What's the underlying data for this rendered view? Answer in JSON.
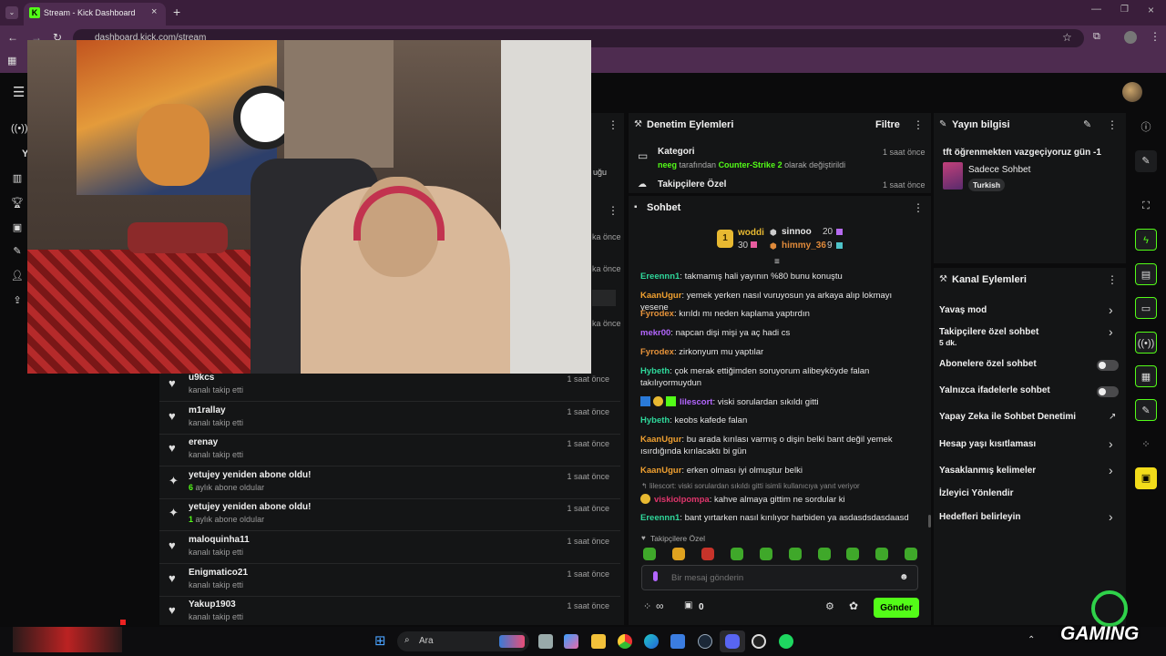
{
  "browser": {
    "tab_title": "Stream - Kick Dashboard",
    "url": "dashboard.kick.com/stream"
  },
  "left_panel": {
    "partial_text_1": "uğu",
    "partial_times": [
      "ka önce",
      "ka önce",
      "ka önce"
    ],
    "feed": [
      {
        "name": "u9kcs",
        "desc": "kanalı takip etti",
        "time": "1 saat önce",
        "type": "follow"
      },
      {
        "name": "m1rallay",
        "desc": "kanalı takip etti",
        "time": "1 saat önce",
        "type": "follow"
      },
      {
        "name": "erenay",
        "desc": "kanalı takip etti",
        "time": "1 saat önce",
        "type": "follow"
      },
      {
        "name": "yetujey yeniden abone oldu!",
        "desc_num": "6",
        "desc": " aylık abone oldular",
        "time": "1 saat önce",
        "type": "sub"
      },
      {
        "name": "yetujey yeniden abone oldu!",
        "desc_num": "1",
        "desc": " aylık abone oldular",
        "time": "1 saat önce",
        "type": "sub"
      },
      {
        "name": "maloquinha11",
        "desc": "kanalı takip etti",
        "time": "1 saat önce",
        "type": "follow"
      },
      {
        "name": "Enigmatico21",
        "desc": "kanalı takip etti",
        "time": "1 saat önce",
        "type": "follow"
      },
      {
        "name": "Yakup1903",
        "desc": "kanalı takip etti",
        "time": "1 saat önce",
        "type": "follow"
      }
    ]
  },
  "moderation": {
    "title": "Denetim Eylemleri",
    "filter_label": "Filtre",
    "entries": [
      {
        "title": "Kategori",
        "user": "neeg",
        "mid": " tarafından ",
        "category": "Counter-Strike 2",
        "tail": " olarak değiştirildi",
        "time": "1 saat önce"
      },
      {
        "title": "Takipçilere Özel",
        "time": "1 saat önce"
      }
    ]
  },
  "chat": {
    "title": "Sohbet",
    "leaderboard": {
      "first": {
        "rank": "1",
        "name": "woddi",
        "value": "30"
      },
      "second": {
        "name": "sinnoo",
        "value": "20"
      },
      "third": {
        "name": "himmy_36",
        "value": "9"
      }
    },
    "messages": [
      {
        "user": "Ereennn1",
        "color": "#2fd89b",
        "text": "takmamış hali yayının %80 bunu konuştu"
      },
      {
        "user": "KaanUgur",
        "color": "#f0a030",
        "text": "yemek yerken nasıl vuruyosun ya arkaya alıp lokmayı yesene"
      },
      {
        "user": "Fyrodex",
        "color": "#e7933a",
        "text": "kırıldı mı neden kaplama yaptırdın"
      },
      {
        "user": "mekr00",
        "color": "#b366ff",
        "text": "napcan dişi mişi ya aç hadi cs"
      },
      {
        "user": "Fyrodex",
        "color": "#e7933a",
        "text": "zirkonyum mu yaptılar"
      },
      {
        "user": "Hybeth",
        "color": "#2fd89b",
        "text": "çok merak ettiğimden soruyorum alibeyköyde falan takılıyormuydun"
      },
      {
        "user": "lilescort",
        "color": "#b366ff",
        "text": "viski sorulardan sıkıldı gitti"
      },
      {
        "user": "Hybeth",
        "color": "#2fd89b",
        "text": "keobs kafede falan"
      },
      {
        "user": "KaanUgur",
        "color": "#f0a030",
        "text": "bu arada kırılası varmış o dişin belki bant değil yemek ısırdığında kırılacaktı bi gün"
      },
      {
        "user": "KaanUgur",
        "color": "#f0a030",
        "text": "erken olması iyi olmuştur belki"
      },
      {
        "user": "viskiolpompa",
        "color": "#e0356c",
        "text": "kahve almaya gittim ne sordular ki"
      },
      {
        "user": "Ereennn1",
        "color": "#2fd89b",
        "text": "bant yırtarken nasıl kırılıyor harbiden ya asdasdsdasdaasd"
      }
    ],
    "reply_hint": "lilescort: viski sorulardan sıkıldı gitti isimli kullanıcıya yanıt veriyor",
    "followers_only": "Takipçilere Özel",
    "input_placeholder": "Bir mesaj gönderin",
    "send_label": "Gönder",
    "points": "0",
    "infinity": "∞"
  },
  "stream_info": {
    "title": "Yayın bilgisi",
    "stream_title": "tft öğrenmekten vazgeçiyoruz gün -1",
    "category": "Sadece Sohbet",
    "language": "Turkish"
  },
  "channel_actions": {
    "title": "Kanal Eylemleri",
    "items": [
      {
        "label": "Yavaş mod",
        "control": "chevron"
      },
      {
        "label": "Takipçilere özel sohbet",
        "sub": "5 dk.",
        "control": "chevron"
      },
      {
        "label": "Abonelere özel sohbet",
        "control": "toggle"
      },
      {
        "label": "Yalnızca ifadelerle sohbet",
        "control": "toggle"
      },
      {
        "label": "Yapay Zeka ile Sohbet Denetimi",
        "control": "external"
      },
      {
        "label": "Hesap yaşı kısıtlaması",
        "control": "chevron"
      },
      {
        "label": "Yasaklanmış kelimeler",
        "control": "chevron"
      },
      {
        "label": "İzleyici Yönlendir",
        "control": "none"
      },
      {
        "label": "Hedefleri belirleyin",
        "control": "chevron"
      }
    ]
  },
  "taskbar": {
    "search_label": "Ara"
  },
  "watermark": {
    "text": "GAMING"
  },
  "colors": {
    "kick_green": "#53fc18",
    "panel": "#141516",
    "browser_purple": "#4e2c50"
  }
}
